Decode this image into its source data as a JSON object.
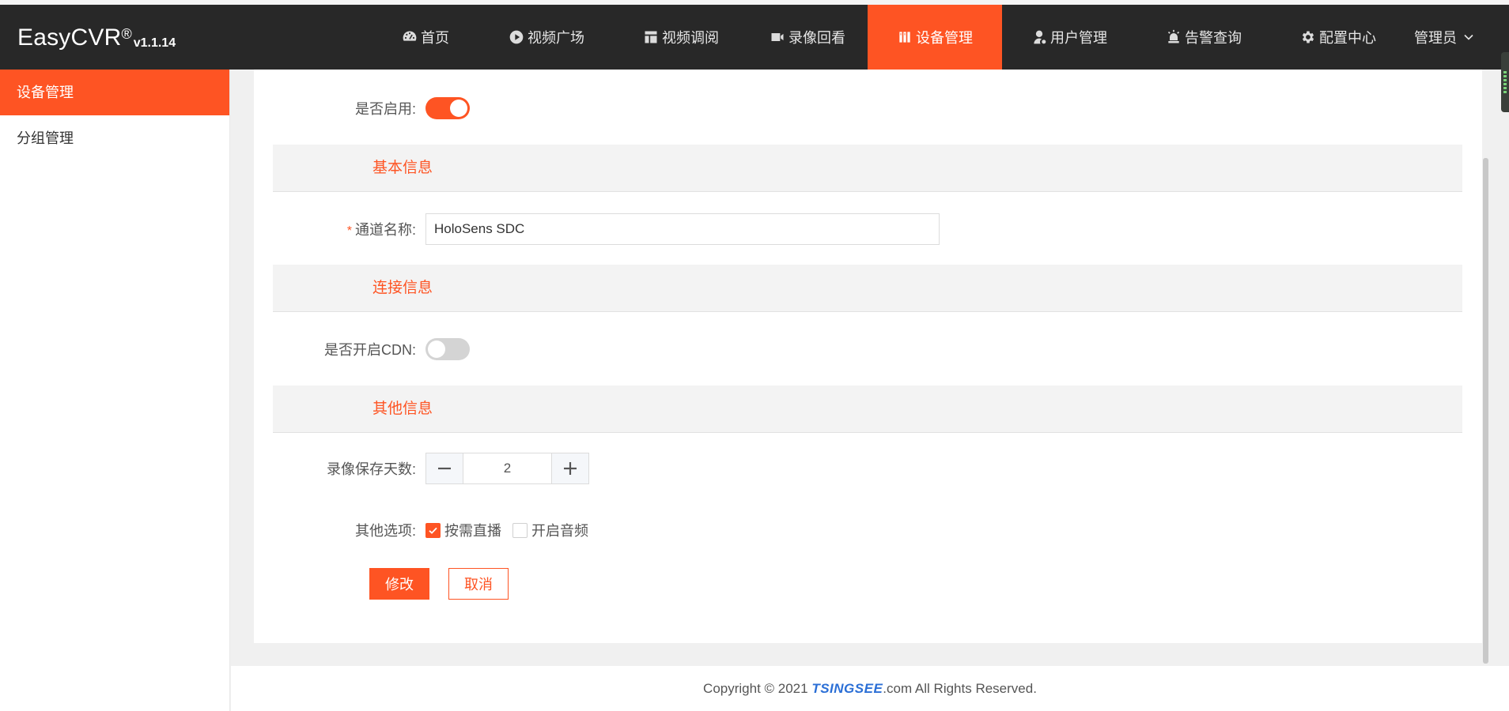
{
  "app": {
    "brand": "EasyCVR",
    "registered": "®",
    "version": "v1.1.14"
  },
  "nav": {
    "items": [
      {
        "label": "首页",
        "icon": "dashboard-icon"
      },
      {
        "label": "视频广场",
        "icon": "play-circle-icon"
      },
      {
        "label": "视频调阅",
        "icon": "layout-icon"
      },
      {
        "label": "录像回看",
        "icon": "video-camera-icon"
      },
      {
        "label": "设备管理",
        "icon": "device-icon",
        "active": true
      },
      {
        "label": "用户管理",
        "icon": "user-icon"
      },
      {
        "label": "告警查询",
        "icon": "alarm-icon"
      },
      {
        "label": "配置中心",
        "icon": "gear-icon"
      }
    ],
    "admin_label": "管理员"
  },
  "sidebar": {
    "items": [
      {
        "label": "设备管理",
        "active": true
      },
      {
        "label": "分组管理",
        "active": false
      }
    ]
  },
  "form": {
    "enable": {
      "label": "是否启用:",
      "value": true
    },
    "section_basic": "基本信息",
    "channel_name": {
      "required_mark": "*",
      "label": "通道名称:",
      "value": "HoloSens SDC"
    },
    "section_connection": "连接信息",
    "cdn": {
      "label": "是否开启CDN:",
      "value": false
    },
    "section_other": "其他信息",
    "record_days": {
      "label": "录像保存天数:",
      "value": "2"
    },
    "options": {
      "label": "其他选项:",
      "items": [
        {
          "label": "按需直播",
          "checked": true
        },
        {
          "label": "开启音频",
          "checked": false
        }
      ]
    },
    "submit_label": "修改",
    "cancel_label": "取消"
  },
  "footer": {
    "prefix": "Copyright © 2021 ",
    "brand": "TSINGSEE",
    "suffix": ".com All Rights Reserved."
  },
  "colors": {
    "accent": "#fe5423",
    "topbar": "#282828"
  }
}
